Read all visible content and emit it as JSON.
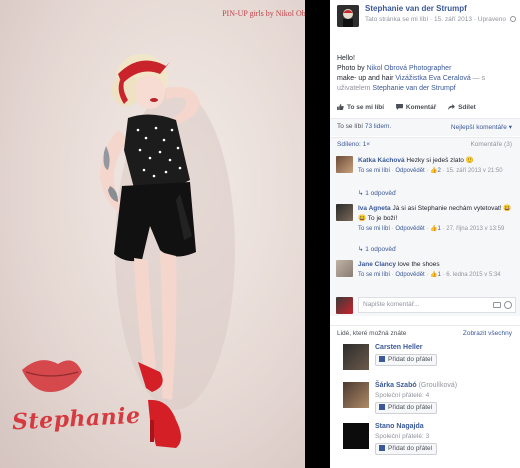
{
  "photo": {
    "credit": "PIN-UP girls by Nikol Obrová",
    "signature": "Stephanie"
  },
  "post": {
    "page_name": "Stephanie van der Strumpf",
    "meta_liked": "Tato stránka se mi líbí",
    "meta_date": "15. září 2013",
    "meta_edited": "Upraveno",
    "caption_line1": "Hello!",
    "caption_photo_prefix": "Photo by ",
    "caption_photographer": "Nikol Obrová Photographer",
    "caption_makeup_prefix": "make- up and hair ",
    "caption_makeup": "Vizážistka Eva Ceralová",
    "caption_with": " — s",
    "caption_user_prefix": "uživatelem ",
    "caption_user": "Stephanie van der Strumpf"
  },
  "actions": {
    "like": "To se mi líbí",
    "comment": "Komentář",
    "share": "Sdílet"
  },
  "stats": {
    "likes_prefix": "To se líbí ",
    "likes_link": "73 lidem",
    "likes_suffix": ".",
    "sort": "Nejlepší komentáře ▾",
    "shared": "Sdíleno: 1×",
    "comment_count": "Komentáře (3)"
  },
  "comments": [
    {
      "name": "Katka Káchová",
      "text": "Hezky si jedeš zlato 🙂",
      "like": "To se mi líbí",
      "reply": "Odpovědět",
      "likes": "2",
      "date": "15. září 2013 v 21:50",
      "replies": "1 odpověď"
    },
    {
      "name": "Iva Agneta",
      "text": "Já si asi Stephanie nechám vytetovat! 😃 😃 To je boží!",
      "like": "To se mi líbí",
      "reply": "Odpovědět",
      "likes": "1",
      "date": "27. října 2013 v 13:59",
      "replies": "1 odpověď"
    },
    {
      "name": "Jane Clancy",
      "text": "love the shoes",
      "like": "To se mi líbí",
      "reply": "Odpovědět",
      "likes": "1",
      "date": "6. ledna 2015 v 5:34",
      "replies": ""
    }
  ],
  "write_comment": {
    "placeholder": "Napište komentář..."
  },
  "pymk": {
    "title": "Lidé, které možná znáte",
    "see_all": "Zobrazit všechny",
    "add_label": "Přidat do přátel",
    "people": [
      {
        "name": "Carsten Heller",
        "alt": "",
        "mutual": ""
      },
      {
        "name": "Šárka Szabó",
        "alt": " (Groulíková)",
        "mutual": "Společní přátelé: 4"
      },
      {
        "name": "Stano Nagajda",
        "alt": "",
        "mutual": "Společní přátelé: 3"
      }
    ]
  },
  "colors": {
    "link": "#3b5998",
    "lips": "#d43a3f"
  }
}
